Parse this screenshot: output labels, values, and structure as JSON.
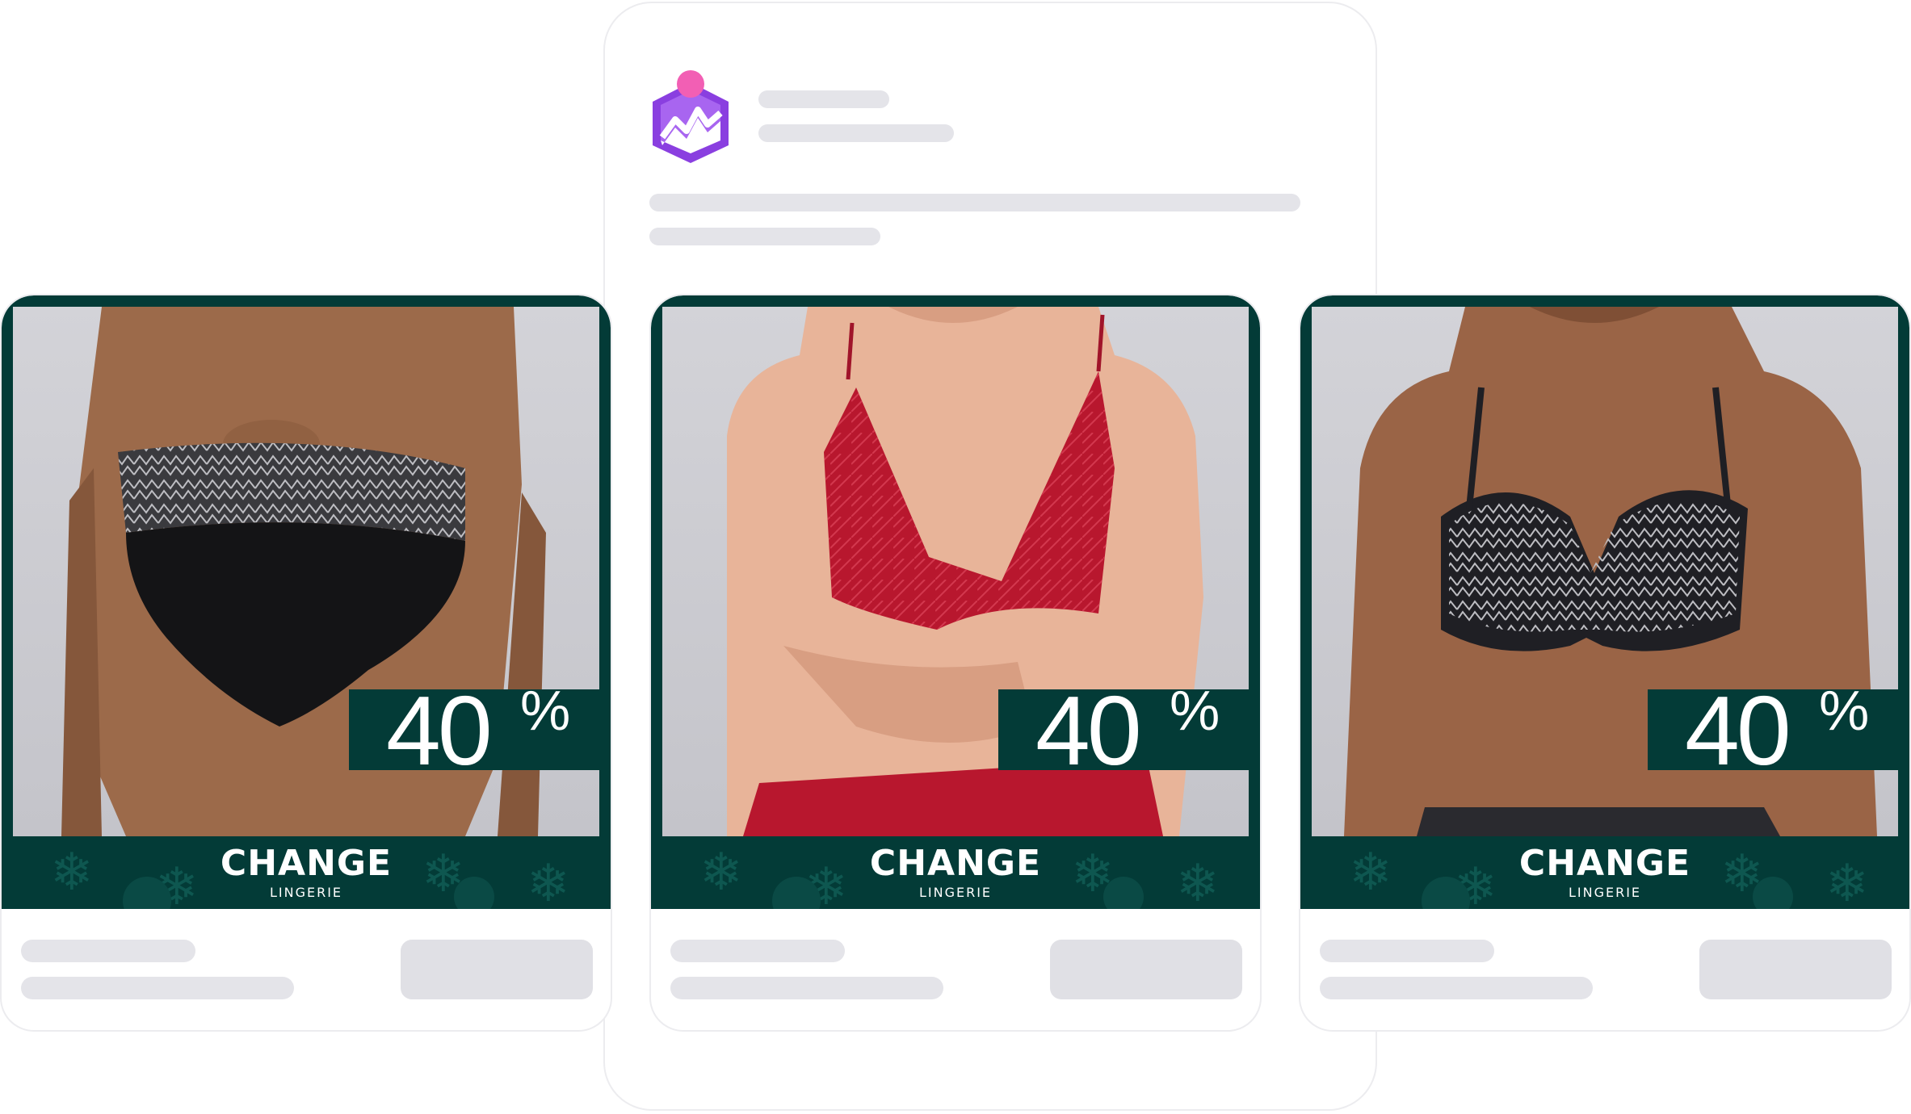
{
  "ads": [
    {
      "discount_value": "40",
      "discount_symbol": "%",
      "brand": "CHANGE",
      "brand_sub": "LINGERIE",
      "product": "bikini-bottom"
    },
    {
      "discount_value": "40",
      "discount_symbol": "%",
      "brand": "CHANGE",
      "brand_sub": "LINGERIE",
      "product": "red-lace-bra"
    },
    {
      "discount_value": "40",
      "discount_symbol": "%",
      "brand": "CHANGE",
      "brand_sub": "LINGERIE",
      "product": "bikini-top"
    }
  ],
  "colors": {
    "banner": "#033b37",
    "skeleton": "#e4e4e9",
    "accent_purple": "#9b4ee6",
    "accent_pink": "#f25fb4"
  },
  "icons": {
    "app_avatar": "chart-cube-icon",
    "decor": "snowflake-icon"
  }
}
